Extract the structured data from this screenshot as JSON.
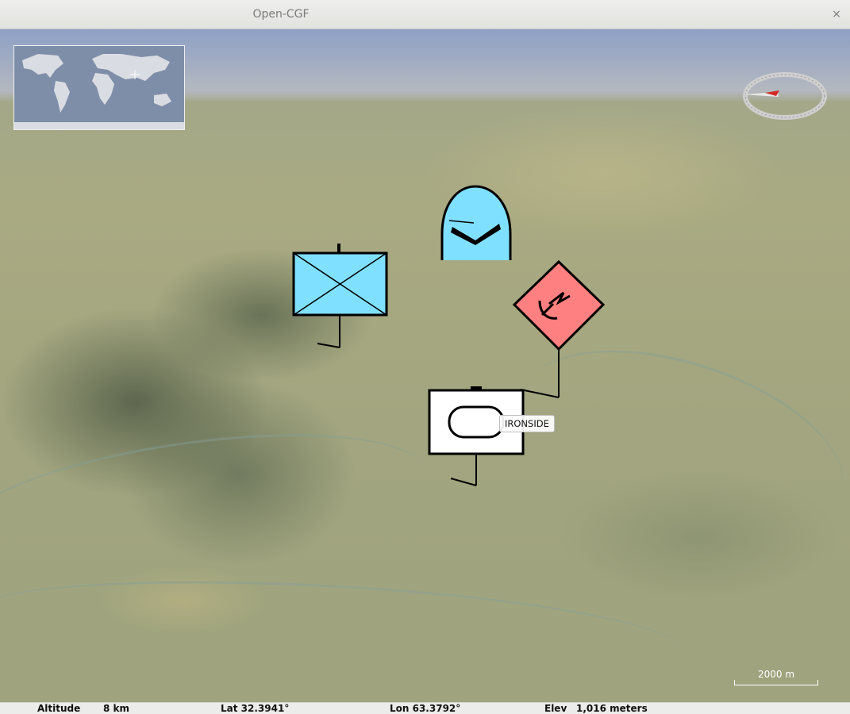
{
  "window": {
    "title": "Open-CGF",
    "close_glyph": "×"
  },
  "map": {
    "icons": [
      "world-minimap",
      "compass-icon",
      "scale-bar"
    ],
    "units": [
      {
        "name": "infantry-unit",
        "fill": "#80e0ff"
      },
      {
        "name": "air-unit",
        "fill": "#80e0ff"
      },
      {
        "name": "hostile-unit",
        "fill": "#ff8080"
      },
      {
        "name": "ironside-unit",
        "fill": "#ffffff"
      }
    ],
    "callout_label": "IRONSIDE",
    "scale_label": "2000 m"
  },
  "status": {
    "altitude_label": "Altitude",
    "altitude_value": "8 km",
    "lat": "Lat 32.3941°",
    "lon": "Lon 63.3792°",
    "elev_label": "Elev",
    "elev_value": "1,016 meters"
  }
}
